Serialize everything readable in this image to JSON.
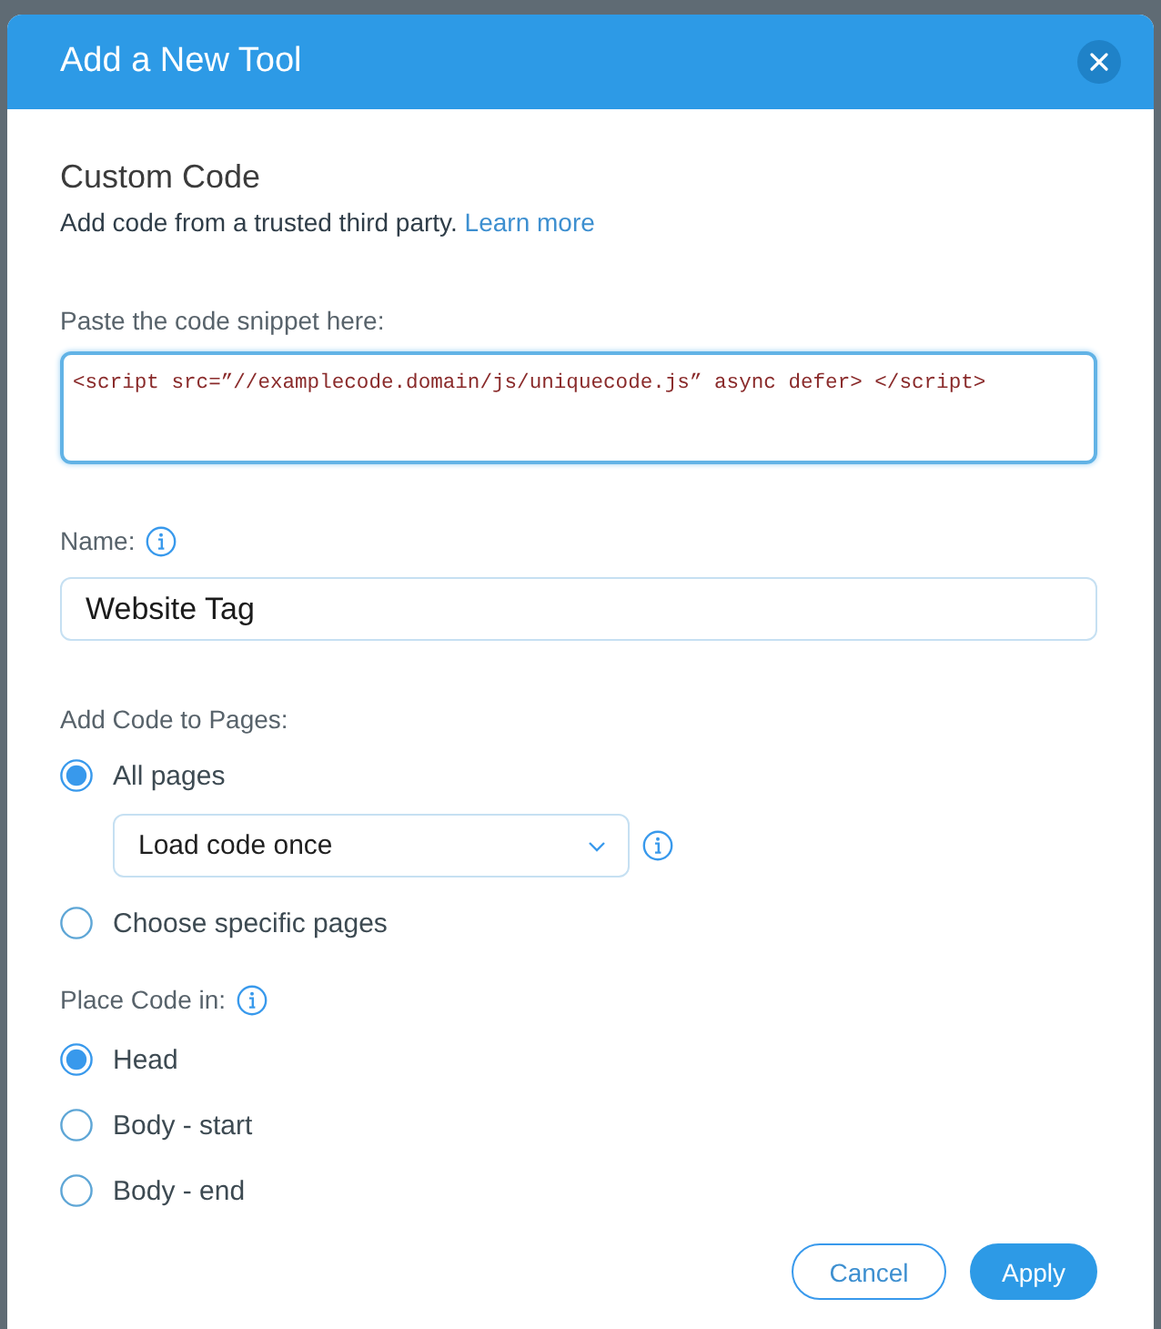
{
  "dialog": {
    "title": "Add a New Tool"
  },
  "section": {
    "heading": "Custom Code",
    "description": "Add code from a trusted third party.",
    "link": "Learn more"
  },
  "code_snippet": {
    "label": "Paste the code snippet here:",
    "value": "<script src=”//examplecode.domain/js/uniquecode.js” async defer> </script>",
    "focused": true
  },
  "name_field": {
    "label": "Name:",
    "value": "Website Tag"
  },
  "add_code_to_pages": {
    "label": "Add Code to Pages:",
    "options": [
      {
        "label": "All pages",
        "selected": true,
        "dropdown": {
          "value": "Load code once"
        }
      },
      {
        "label": "Choose specific pages",
        "selected": false
      }
    ]
  },
  "place_code_in": {
    "label": "Place Code in:",
    "options": [
      {
        "label": "Head",
        "selected": true
      },
      {
        "label": "Body - start",
        "selected": false
      },
      {
        "label": "Body - end",
        "selected": false
      }
    ]
  },
  "buttons": [
    {
      "label": "Cancel",
      "kind": "secondary"
    },
    {
      "label": "Apply",
      "kind": "primary"
    }
  ]
}
